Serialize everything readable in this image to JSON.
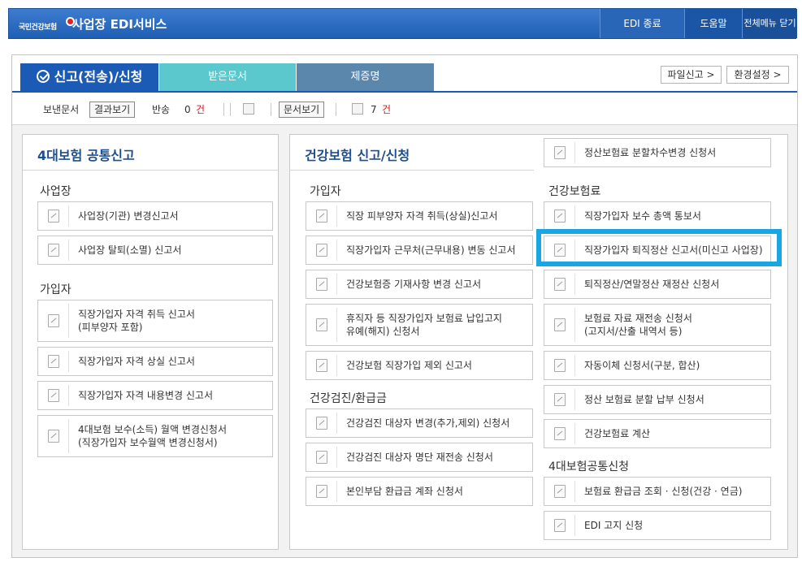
{
  "header": {
    "logo_text": "국민건강보험",
    "app_title": "사업장 EDI서비스",
    "edi_close": "EDI 종료",
    "help": "도움말",
    "close_all_menu": "전체메뉴 닫기"
  },
  "tabs": {
    "report": "신고(전송)/신청",
    "received": "받은문서",
    "certificate": "제증명"
  },
  "top_buttons": {
    "file_report": "파일신고 >",
    "env_settings": "환경설정 >"
  },
  "toolbar": {
    "sent_label": "보낸문서",
    "result_view": "결과보기",
    "return_label": "반송",
    "return_count": "0",
    "count_unit": "건",
    "doc_view": "문서보기",
    "doc_count": "7",
    "doc_unit": "건"
  },
  "left_panel": {
    "title": "4대보험 공통신고",
    "sec_workplace": "사업장",
    "sec_subscriber": "가입자",
    "workplace_items": [
      "사업장(기관) 변경신고서",
      "사업장 탈퇴(소멸) 신고서"
    ],
    "subscriber_items": [
      "직장가입자 자격 취득 신고서\n(피부양자 포함)",
      "직장가입자 자격 상실 신고서",
      "직장가입자 자격 내용변경 신고서",
      "4대보험 보수(소득) 월액 변경신청서\n(직장가입자 보수월액 변경신청서)"
    ]
  },
  "right_panel": {
    "title": "건강보험 신고/신청",
    "top_item": "정산보험료 분할차수변경 신청서",
    "sec_subscriber": "가입자",
    "subscriber_items": [
      "직장 피부양자 자격 취득(상실)신고서",
      "직장가입자 근무처(근무내용) 변동 신고서",
      "건강보험증 기재사항 변경 신고서",
      "휴직자 등 직장가입자 보험료 납입고지\n유예(해지) 신청서",
      "건강보험 직장가입 제외 신고서"
    ],
    "sec_checkup": "건강검진/환급금",
    "checkup_items": [
      "건강검진 대상자 변경(추가,제외) 신청서",
      "건강검진 대상자 명단 재전송 신청서",
      "본인부담 환급금 계좌 신청서"
    ],
    "sec_premium": "건강보험료",
    "premium_items": [
      "직장가입자 보수 총액 통보서",
      "직장가입자 퇴직정산 신고서(미신고 사업장)",
      "퇴직정산/연말정산 재정산 신청서",
      "보험료 자료 재전송 신청서\n(고지서/산출 내역서 등)",
      "자동이체 신청서(구분, 합산)",
      "정산 보험료 분할 납부 신청서",
      "건강보험료 계산"
    ],
    "sec_common": "4대보험공통신청",
    "common_items": [
      "보험료 환급금 조회 · 신청(건강 · 연금)",
      "EDI 고지 신청"
    ]
  },
  "colors": {
    "brand_blue": "#1b5bb5",
    "highlight": "#1aa6e3",
    "tab_teal": "#5ac8cc",
    "tab_slate": "#5c87ad"
  }
}
